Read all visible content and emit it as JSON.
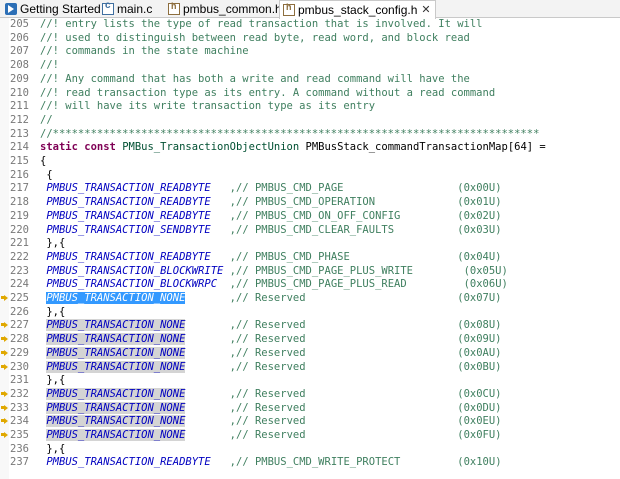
{
  "tabs": [
    {
      "label": "Getting Started",
      "icon": "getting-started-icon",
      "active": false
    },
    {
      "label": "main.c",
      "icon": "c-file-icon",
      "active": false
    },
    {
      "label": "pmbus_common.h",
      "icon": "h-file-icon",
      "active": false
    },
    {
      "label": "pmbus_stack_config.h",
      "icon": "h-file-icon",
      "active": true,
      "close": "✕"
    }
  ],
  "lines": [
    {
      "n": "205",
      "t": "comment",
      "text": "//! entry lists the type of read transaction that is involved. It will"
    },
    {
      "n": "206",
      "t": "comment",
      "text": "//! used to distinguish between read byte, read word, and block read"
    },
    {
      "n": "207",
      "t": "comment",
      "text": "//! commands in the state machine"
    },
    {
      "n": "208",
      "t": "comment",
      "text": "//!"
    },
    {
      "n": "209",
      "t": "comment",
      "text": "//! Any command that has both a write and read command will have the"
    },
    {
      "n": "210",
      "t": "comment",
      "text": "//! read transaction type as its entry. A command without a read command"
    },
    {
      "n": "211",
      "t": "comment",
      "text": "//! will have its write transaction type as its entry"
    },
    {
      "n": "212",
      "t": "comment",
      "text": "//"
    },
    {
      "n": "213",
      "t": "comment",
      "text": "//*****************************************************************************"
    },
    {
      "n": "214",
      "t": "decl",
      "kw": "static const ",
      "type": "PMBus_TransactionObjectUnion",
      "rest": " PMBusStack_commandTransactionMap[64] ="
    },
    {
      "n": "215",
      "t": "plain",
      "text": "{"
    },
    {
      "n": "216",
      "t": "plain",
      "text": " {"
    },
    {
      "n": "217",
      "t": "entry",
      "mac": "PMBUS_TRANSACTION_READBYTE",
      "pad": "   ",
      "cmt": ",// PMBUS_CMD_PAGE",
      "pad2": "                  ",
      "hex": "(0x00U)"
    },
    {
      "n": "218",
      "t": "entry",
      "mac": "PMBUS_TRANSACTION_READBYTE",
      "pad": "   ",
      "cmt": ",// PMBUS_CMD_OPERATION",
      "pad2": "             ",
      "hex": "(0x01U)"
    },
    {
      "n": "219",
      "t": "entry",
      "mac": "PMBUS_TRANSACTION_READBYTE",
      "pad": "   ",
      "cmt": ",// PMBUS_CMD_ON_OFF_CONFIG",
      "pad2": "         ",
      "hex": "(0x02U)"
    },
    {
      "n": "220",
      "t": "entry",
      "mac": "PMBUS_TRANSACTION_SENDBYTE",
      "pad": "   ",
      "cmt": ",// PMBUS_CMD_CLEAR_FAULTS",
      "pad2": "          ",
      "hex": "(0x03U)"
    },
    {
      "n": "221",
      "t": "plain",
      "text": " },{"
    },
    {
      "n": "222",
      "t": "entry",
      "mac": "PMBUS_TRANSACTION_READBYTE",
      "pad": "   ",
      "cmt": ",// PMBUS_CMD_PHASE",
      "pad2": "                 ",
      "hex": "(0x04U)"
    },
    {
      "n": "223",
      "t": "entry",
      "mac": "PMBUS_TRANSACTION_BLOCKWRITE",
      "pad": " ",
      "cmt": ",// PMBUS_CMD_PAGE_PLUS_WRITE",
      "pad2": "        ",
      "hex": "(0x05U)"
    },
    {
      "n": "224",
      "t": "entry",
      "mac": "PMBUS_TRANSACTION_BLOCKWRPC",
      "pad": "  ",
      "cmt": ",// PMBUS_CMD_PAGE_PLUS_READ",
      "pad2": "         ",
      "hex": "(0x06U)"
    },
    {
      "n": "225",
      "t": "entry",
      "mac": "PMBUS_TRANSACTION_NONE",
      "pad": "       ",
      "cmt": ",// Reserved",
      "pad2": "                        ",
      "hex": "(0x07U)",
      "hl": "sel",
      "arrow": true
    },
    {
      "n": "226",
      "t": "plain",
      "text": " },{"
    },
    {
      "n": "227",
      "t": "entry",
      "mac": "PMBUS_TRANSACTION_NONE",
      "pad": "       ",
      "cmt": ",// Reserved",
      "pad2": "                        ",
      "hex": "(0x08U)",
      "hl": "occ",
      "arrow": true
    },
    {
      "n": "228",
      "t": "entry",
      "mac": "PMBUS_TRANSACTION_NONE",
      "pad": "       ",
      "cmt": ",// Reserved",
      "pad2": "                        ",
      "hex": "(0x09U)",
      "hl": "occ",
      "arrow": true
    },
    {
      "n": "229",
      "t": "entry",
      "mac": "PMBUS_TRANSACTION_NONE",
      "pad": "       ",
      "cmt": ",// Reserved",
      "pad2": "                        ",
      "hex": "(0x0AU)",
      "hl": "occ",
      "arrow": true
    },
    {
      "n": "230",
      "t": "entry",
      "mac": "PMBUS_TRANSACTION_NONE",
      "pad": "       ",
      "cmt": ",// Reserved",
      "pad2": "                        ",
      "hex": "(0x0BU)",
      "hl": "occ",
      "arrow": true
    },
    {
      "n": "231",
      "t": "plain",
      "text": " },{"
    },
    {
      "n": "232",
      "t": "entry",
      "mac": "PMBUS_TRANSACTION_NONE",
      "pad": "       ",
      "cmt": ",// Reserved",
      "pad2": "                        ",
      "hex": "(0x0CU)",
      "hl": "occ",
      "arrow": true
    },
    {
      "n": "233",
      "t": "entry",
      "mac": "PMBUS_TRANSACTION_NONE",
      "pad": "       ",
      "cmt": ",// Reserved",
      "pad2": "                        ",
      "hex": "(0x0DU)",
      "hl": "occ",
      "arrow": true
    },
    {
      "n": "234",
      "t": "entry",
      "mac": "PMBUS_TRANSACTION_NONE",
      "pad": "       ",
      "cmt": ",// Reserved",
      "pad2": "                        ",
      "hex": "(0x0EU)",
      "hl": "occ",
      "arrow": true
    },
    {
      "n": "235",
      "t": "entry",
      "mac": "PMBUS_TRANSACTION_NONE",
      "pad": "       ",
      "cmt": ",// Reserved",
      "pad2": "                        ",
      "hex": "(0x0FU)",
      "hl": "occ",
      "arrow": true
    },
    {
      "n": "236",
      "t": "plain",
      "text": " },{"
    },
    {
      "n": "237",
      "t": "entry",
      "mac": "PMBUS_TRANSACTION_READBYTE",
      "pad": "   ",
      "cmt": ",// PMBUS_CMD_WRITE_PROTECT",
      "pad2": "         ",
      "hex": "(0x10U)"
    }
  ],
  "colors": {
    "comment": "#3f7f5f",
    "keyword": "#7f0055",
    "macro": "#0000c0",
    "selection": "#3399ff",
    "occurrence": "#d4d4d4"
  }
}
